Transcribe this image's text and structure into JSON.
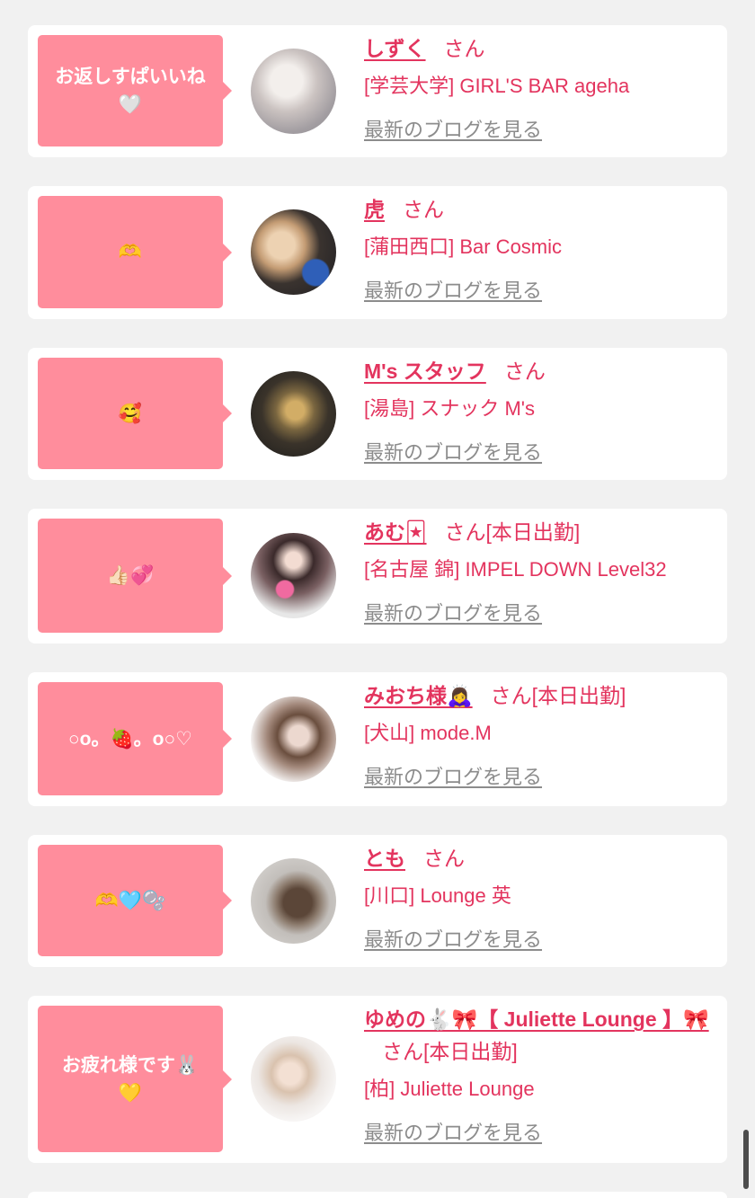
{
  "colors": {
    "page_bg": "#f1f1f1",
    "card_bg": "#ffffff",
    "message_bg": "#ff8d9c",
    "accent": "#e3345e",
    "blog_link": "#8c8c8c",
    "scrollbar": "#4d4d4d"
  },
  "posts": [
    {
      "message": "お返しすぱいいね\n🤍",
      "name": "しずく",
      "honorific": "さん",
      "shop": "[学芸大学] GIRL'S BAR ageha",
      "blog_link": "最新のブログを見る"
    },
    {
      "message": "🫶",
      "name": "虎",
      "honorific": "さん",
      "shop": "[蒲田西口] Bar Cosmic",
      "blog_link": "最新のブログを見る"
    },
    {
      "message": "🥰",
      "name": "M's スタッフ",
      "honorific": "さん",
      "shop": "[湯島] スナック M's",
      "blog_link": "最新のブログを見る"
    },
    {
      "message": "👍🏻💞",
      "name": "あむ🃏",
      "honorific": "さん",
      "status": "[本日出勤]",
      "shop": "[名古屋 錦] IMPEL DOWN Level32",
      "blog_link": "最新のブログを見る"
    },
    {
      "message": "○o。🍓。o○♡",
      "name": "みおち様🙇‍♀️",
      "honorific": "さん",
      "status": "[本日出勤]",
      "shop": "[犬山] mode.M",
      "blog_link": "最新のブログを見る"
    },
    {
      "message": "🫶🩵🫧",
      "name": "とも",
      "honorific": "さん",
      "shop": "[川口] Lounge 英",
      "blog_link": "最新のブログを見る"
    },
    {
      "message": "お疲れ様です🐰\n💛",
      "name": "ゆめの🐇🎀【 Juliette Lounge 】🎀",
      "honorific": "さん",
      "status": "[本日出勤]",
      "shop": "[柏] Juliette Lounge",
      "blog_link": "最新のブログを見る"
    }
  ]
}
